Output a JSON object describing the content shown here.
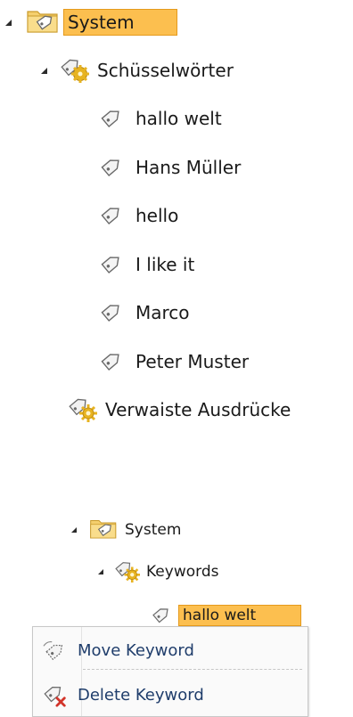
{
  "tree_top": {
    "root": {
      "label": "System",
      "icon": "folder-icon",
      "expanded": true,
      "selected": true
    },
    "keywords_group": {
      "label": "Schüsselwörter",
      "icon": "keyword-group-icon",
      "expanded": true
    },
    "keywords": [
      {
        "label": "hallo welt",
        "icon": "tag-icon"
      },
      {
        "label": "Hans Müller",
        "icon": "tag-icon"
      },
      {
        "label": "hello",
        "icon": "tag-icon"
      },
      {
        "label": "I like it",
        "icon": "tag-icon"
      },
      {
        "label": "Marco",
        "icon": "tag-icon"
      },
      {
        "label": "Peter Muster",
        "icon": "tag-icon"
      }
    ],
    "orphans_group": {
      "label": "Verwaiste Ausdrücke",
      "icon": "keyword-group-icon"
    }
  },
  "tree_bottom": {
    "root": {
      "label": "System",
      "icon": "folder-icon",
      "expanded": true
    },
    "keywords_group": {
      "label": "Keywords",
      "icon": "keyword-group-icon",
      "expanded": true
    },
    "selected_keyword": {
      "label": "hallo welt",
      "icon": "tag-icon",
      "selected": true
    }
  },
  "context_menu": {
    "items": [
      {
        "label": "Move Keyword",
        "icon": "move-tag-icon"
      },
      {
        "label": "Delete Keyword",
        "icon": "delete-tag-icon"
      }
    ]
  },
  "colors": {
    "selection_fill": "#fcbf4f",
    "selection_border": "#e59a1c",
    "menu_text": "#1f3d6b",
    "folder": "#f4cf6e",
    "gear": "#e7b321"
  }
}
